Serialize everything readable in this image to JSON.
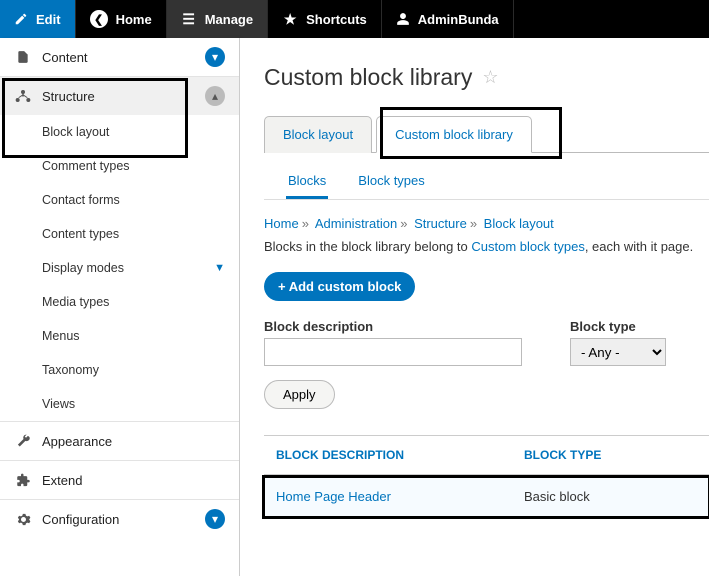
{
  "toolbar": {
    "edit": "Edit",
    "home": "Home",
    "manage": "Manage",
    "shortcuts": "Shortcuts",
    "user": "AdminBunda"
  },
  "sidebar": {
    "content": "Content",
    "structure": "Structure",
    "structure_children": {
      "block_layout": "Block layout",
      "comment_types": "Comment types",
      "contact_forms": "Contact forms",
      "content_types": "Content types",
      "display_modes": "Display modes",
      "media_types": "Media types",
      "menus": "Menus",
      "taxonomy": "Taxonomy",
      "views": "Views"
    },
    "appearance": "Appearance",
    "extend": "Extend",
    "configuration": "Configuration"
  },
  "page": {
    "title": "Custom block library",
    "primary_tabs": {
      "block_layout": "Block layout",
      "cbl": "Custom block library"
    },
    "secondary_tabs": {
      "blocks": "Blocks",
      "block_types": "Block types"
    },
    "breadcrumb": {
      "home": "Home",
      "admin": "Administration",
      "structure": "Structure",
      "block_layout": "Block layout"
    },
    "lead_pre": "Blocks in the block library belong to ",
    "lead_link": "Custom block types",
    "lead_post": ", each with it page.",
    "add_btn": "+ Add custom block",
    "filter_desc_label": "Block description",
    "filter_type_label": "Block type",
    "filter_type_value": "- Any -",
    "apply": "Apply",
    "th_desc": "BLOCK DESCRIPTION",
    "th_type": "BLOCK TYPE",
    "row_link": "Home Page Header",
    "row_type": "Basic block"
  }
}
